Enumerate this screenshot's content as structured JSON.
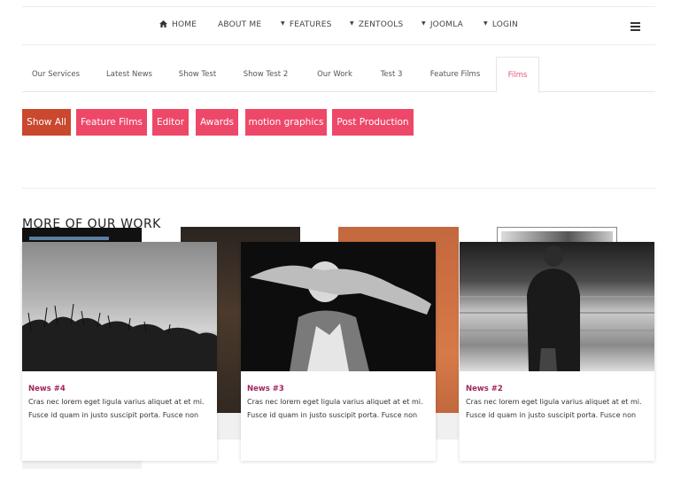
{
  "nav": {
    "items": [
      {
        "label": "HOME",
        "icon": "home-icon"
      },
      {
        "label": "ABOUT ME"
      },
      {
        "label": "FEATURES",
        "caret": true
      },
      {
        "label": "ZENTOOLS",
        "caret": true
      },
      {
        "label": "JOOMLA",
        "caret": true
      },
      {
        "label": "LOGIN",
        "caret": true
      }
    ],
    "menu_icon": "hamburger-icon"
  },
  "tabs": [
    {
      "label": "Our Services"
    },
    {
      "label": "Latest News"
    },
    {
      "label": "Show Test"
    },
    {
      "label": "Show Test 2"
    },
    {
      "label": "Our Work"
    },
    {
      "label": "Test 3"
    },
    {
      "label": "Feature Films"
    },
    {
      "label": "Films",
      "active": true
    }
  ],
  "filters": [
    {
      "label": "Show All",
      "active": true
    },
    {
      "label": "Feature Films"
    },
    {
      "label": "Editor"
    },
    {
      "label": "Awards"
    },
    {
      "label": "motion graphics"
    },
    {
      "label": "Post Production"
    }
  ],
  "section_heading": "MORE OF OUR WORK",
  "cards": [
    {
      "title": "News #4",
      "text": "Cras nec lorem eget ligula varius aliquet at et mi. Fusce id quam in justo suscipit porta. Fusce non"
    },
    {
      "title": "News #3",
      "text": "Cras nec lorem eget ligula varius aliquet at et mi. Fusce id quam in justo suscipit porta. Fusce non"
    },
    {
      "title": "News #2",
      "text": "Cras nec lorem eget ligula varius aliquet at et mi. Fusce id quam in justo suscipit porta. Fusce non"
    }
  ],
  "colors": {
    "filter_button": "#ee4869",
    "filter_active": "#c9482e",
    "card_title": "#a0245f",
    "active_tab": "#e05a7a"
  }
}
